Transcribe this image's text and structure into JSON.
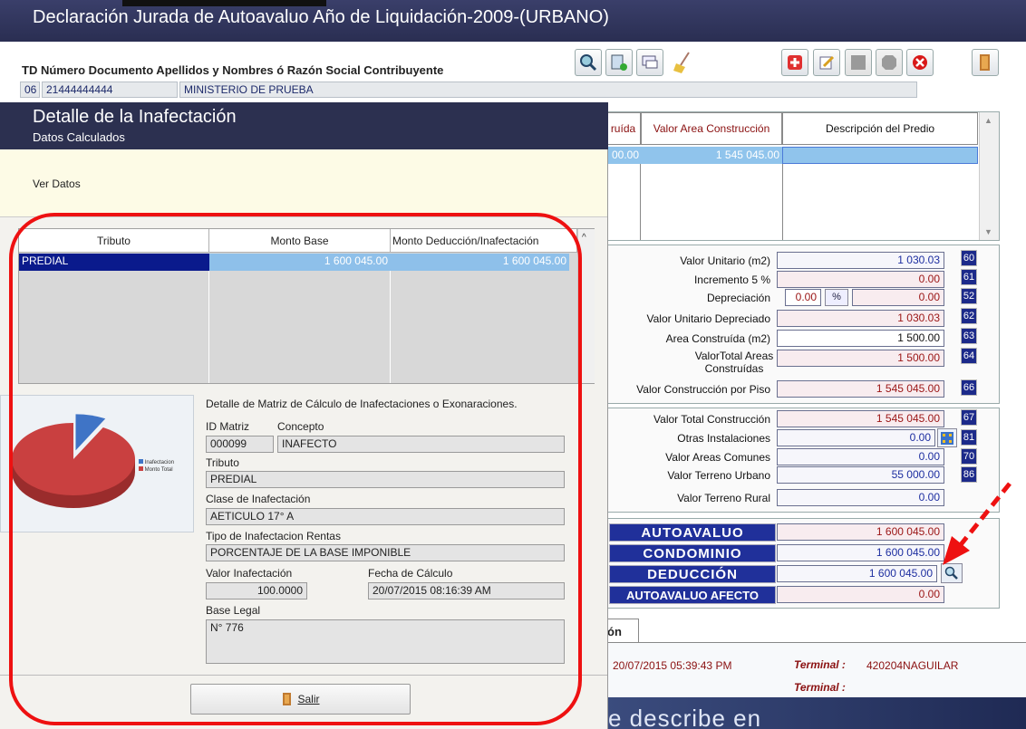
{
  "window": {
    "title": "Declaración Jurada de Autoavaluo Año de Liquidación-2009-(URBANO)"
  },
  "header": {
    "label": "TD Número Documento Apellidos y Nombres ó Razón Social Contribuyente",
    "td": "06",
    "documento": "21444444444",
    "nombre": "MINISTERIO DE PRUEBA"
  },
  "dialog": {
    "title": "Detalle de la Inafectación",
    "subtitle": "Datos Calculados",
    "ver_datos": "Ver Datos",
    "grid": {
      "headers": [
        "Tributo",
        "Monto Base",
        "Monto Deducción/Inafectación"
      ],
      "rows": [
        [
          "PREDIAL",
          "1 600 045.00",
          "1 600 045.00"
        ]
      ]
    },
    "pie_legend": [
      "Inafectacion",
      "Monto Total"
    ],
    "detail_title": "Detalle de Matriz de Cálculo de Inafectaciones o Exonaraciones.",
    "id_matriz_label": "ID Matriz",
    "id_matriz": "000099",
    "concepto_label": "Concepto",
    "concepto": "INAFECTO",
    "tributo_label": "Tributo",
    "tributo": "PREDIAL",
    "clase_label": "Clase de Inafectación",
    "clase": "AETICULO 17° A",
    "tipo_label": "Tipo de Inafectacion Rentas",
    "tipo": "PORCENTAJE DE LA BASE IMPONIBLE",
    "valor_label": "Valor Inafectación",
    "valor": "100.0000",
    "fecha_label": "Fecha de Cálculo",
    "fecha": "20/07/2015 08:16:39 AM",
    "base_label": "Base Legal",
    "base": "N° 776",
    "salir": "Salir",
    "pie": {
      "inafectacion": 0.08,
      "monto_total": 0.92
    }
  },
  "right": {
    "grid_headers": [
      "ruída",
      "Valor Area Construcción",
      "Descripción del Predio"
    ],
    "grid_row": [
      "00.00",
      "1 545 045.00",
      ""
    ],
    "fields": [
      {
        "label": "Valor Unitario (m2)",
        "value": "1 030.03",
        "code": "60"
      },
      {
        "label": "Incremento  5 %",
        "value": "0.00",
        "code": "61"
      },
      {
        "label": "Depreciación",
        "value": "0.00",
        "code": "52"
      },
      {
        "label": "Valor Unitario Depreciado",
        "value": "1 030.03",
        "code": "62"
      },
      {
        "label": "Area Construída (m2)",
        "value": "1 500.00",
        "code": "63"
      },
      {
        "label": "ValorTotal Areas Construídas",
        "value": "1 500.00",
        "code": "64"
      },
      {
        "label": "Valor Construcción por Piso",
        "value": "1 545 045.00",
        "code": "66"
      }
    ],
    "deprec_pct": "0.00",
    "pct_symbol": "%",
    "totals": [
      {
        "label": "Valor Total Construcción",
        "value": "1 545 045.00",
        "code": "67"
      },
      {
        "label": "Otras Instalaciones",
        "value": "0.00",
        "code": "81"
      },
      {
        "label": "Valor Areas Comunes",
        "value": "0.00",
        "code": "70"
      },
      {
        "label": "Valor Terreno Urbano",
        "value": "55 000.00",
        "code": "86"
      },
      {
        "label": "Valor Terreno Rural",
        "value": "0.00",
        "code": ""
      }
    ],
    "summary": [
      {
        "label": "AUTOAVALUO",
        "value": "1 600 045.00"
      },
      {
        "label": "CONDOMINIO",
        "value": "1 600 045.00"
      },
      {
        "label": "DEDUCCIÓN",
        "value": "1 600 045.00"
      },
      {
        "label": "AUTOAVALUO AFECTO",
        "value": "0.00"
      }
    ],
    "tab_label": "ón",
    "status_time": "20/07/2015 05:39:43 PM",
    "terminal_label": "Terminal :",
    "terminal_value": "420204NAGUILAR",
    "terminal2_label": "Terminal :",
    "footer_text": "e describe en"
  },
  "colors": {
    "selection": "#0a1a8c",
    "annotation_red": "#ee1111"
  }
}
